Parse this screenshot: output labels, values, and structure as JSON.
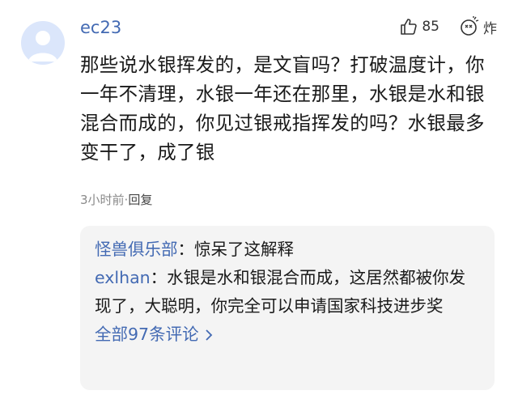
{
  "comment": {
    "username": "ec23",
    "like_count": "85",
    "explode_label": "炸",
    "text": "那些说水银挥发的，是文盲吗？打破温度计，你一年不清理，水银一年还在那里，水银是水和银混合而成的，你见过银戒指挥发的吗？水银最多变干了，成了银",
    "time": "3小时前",
    "separator": "·",
    "reply_label": "回复"
  },
  "replies": [
    {
      "name": "怪兽俱乐部",
      "colon": "：",
      "text": "惊呆了这解释"
    },
    {
      "name": "exlhan",
      "colon": "：",
      "text": "水银是水和银混合而成，这居然都被你发现了，大聪明，你完全可以申请国家科技进步奖"
    }
  ],
  "more_label": "全部97条评论",
  "icons": {
    "like": "thumbs-up-icon",
    "explode": "explode-icon",
    "chevron": "chevron-right-icon"
  },
  "colors": {
    "accent": "#436ab3",
    "reply_bg": "#f4f4f4",
    "avatar_bg": "#dbe6fb"
  }
}
